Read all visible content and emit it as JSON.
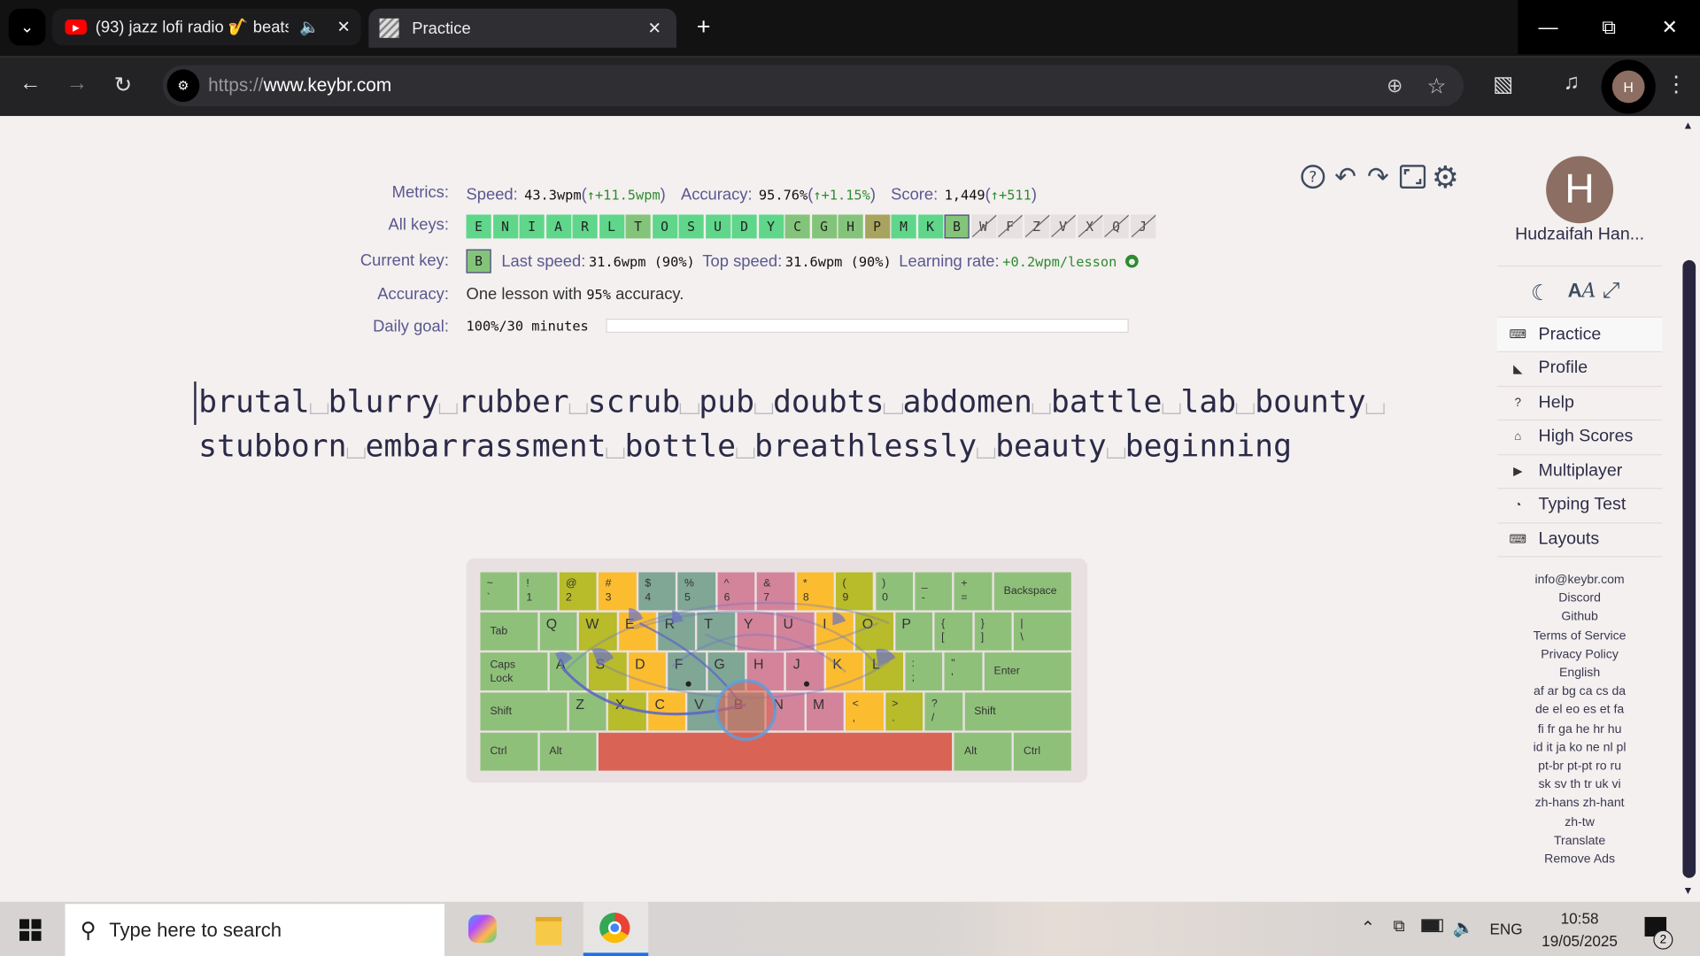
{
  "browser": {
    "tabs": [
      {
        "title": "(93) jazz lofi radio 🎷 beats",
        "active": false,
        "audio": true
      },
      {
        "title": "Practice",
        "active": true
      }
    ],
    "url_scheme": "https://",
    "url_host": "www.keybr.com",
    "profile_initial": "H"
  },
  "metrics": {
    "label": "Metrics:",
    "speed_label": "Speed:",
    "speed": "43.3wpm",
    "speed_delta": "↑+11.5wpm",
    "accuracy_label": "Accuracy:",
    "accuracy": "95.76%",
    "accuracy_delta": "↑+1.15%",
    "score_label": "Score:",
    "score": "1,449",
    "score_delta": "↑+511"
  },
  "all_keys": {
    "label": "All keys:",
    "keys": [
      {
        "k": "E",
        "s": "good"
      },
      {
        "k": "N",
        "s": "good"
      },
      {
        "k": "I",
        "s": "good"
      },
      {
        "k": "A",
        "s": "good"
      },
      {
        "k": "R",
        "s": "good"
      },
      {
        "k": "L",
        "s": "good"
      },
      {
        "k": "T",
        "s": "mid"
      },
      {
        "k": "O",
        "s": "good"
      },
      {
        "k": "S",
        "s": "good"
      },
      {
        "k": "U",
        "s": "good"
      },
      {
        "k": "D",
        "s": "good"
      },
      {
        "k": "Y",
        "s": "good"
      },
      {
        "k": "C",
        "s": "mid"
      },
      {
        "k": "G",
        "s": "mid"
      },
      {
        "k": "H",
        "s": "mid"
      },
      {
        "k": "P",
        "s": "tan"
      },
      {
        "k": "M",
        "s": "good"
      },
      {
        "k": "K",
        "s": "good"
      },
      {
        "k": "B",
        "s": "cur"
      },
      {
        "k": "W",
        "s": "lock"
      },
      {
        "k": "F",
        "s": "lock"
      },
      {
        "k": "Z",
        "s": "lock"
      },
      {
        "k": "V",
        "s": "lock"
      },
      {
        "k": "X",
        "s": "lock"
      },
      {
        "k": "Q",
        "s": "lock"
      },
      {
        "k": "J",
        "s": "lock"
      }
    ]
  },
  "current_key": {
    "label": "Current key:",
    "key": "B",
    "last_speed_label": "Last speed:",
    "last_speed": "31.6wpm (90%)",
    "top_speed_label": "Top speed:",
    "top_speed": "31.6wpm (90%)",
    "learning_rate_label": "Learning rate:",
    "learning_rate": "+0.2wpm/lesson"
  },
  "accuracy_row": {
    "label": "Accuracy:",
    "prefix": "One lesson with ",
    "value": "95%",
    "suffix": " accuracy."
  },
  "daily_goal": {
    "label": "Daily goal:",
    "value": "100%/30 minutes",
    "progress": 1.0
  },
  "lesson_text": [
    "brutal",
    "blurry",
    "rubber",
    "scrub",
    "pub",
    "doubts",
    "abdomen",
    "battle",
    "lab",
    "bounty",
    "|",
    "stubborn",
    "embarrassment",
    "bottle",
    "breathlessly",
    "beauty",
    "beginning"
  ],
  "sidebar": {
    "user_name": "Hudzaifah Han...",
    "avatar_initial": "H",
    "menu": [
      {
        "label": "Practice",
        "icon": "keyboard-icon",
        "glyph": "⌨",
        "active": true
      },
      {
        "label": "Profile",
        "icon": "chart-icon",
        "glyph": "◣"
      },
      {
        "label": "Help",
        "icon": "help-icon",
        "glyph": "?"
      },
      {
        "label": "High Scores",
        "icon": "trophy-icon",
        "glyph": "⌂"
      },
      {
        "label": "Multiplayer",
        "icon": "car-icon",
        "glyph": "▶"
      },
      {
        "label": "Typing Test",
        "icon": "gauge-icon",
        "glyph": "◔"
      },
      {
        "label": "Layouts",
        "icon": "keyboard-icon",
        "glyph": "⌨"
      }
    ],
    "footer": [
      "info@keybr.com",
      "Discord",
      "Github",
      "Terms of Service",
      "Privacy Policy",
      "English",
      "af ar bg ca cs da",
      "de el eo es et fa",
      "fi fr ga he hr hu",
      "id it ja ko ne nl pl",
      "pt-br pt-pt ro ru",
      "sk sv th tr uk vi",
      "zh-hans zh-hant",
      "zh-tw",
      "Translate",
      "Remove Ads"
    ]
  },
  "keyboard": {
    "finger_colors": {
      "lp": "#8fc07a",
      "lr": "#b8bb2a",
      "lm": "#fbbd2f",
      "li": "#80a695",
      "ri": "#d3849a",
      "rm": "#fbbd2f",
      "rr": "#b8bb2a",
      "rp": "#8fc07a",
      "th": "#d96455"
    },
    "rows": [
      [
        [
          "~",
          "`",
          "lp"
        ],
        [
          "!",
          "1",
          "lp"
        ],
        [
          "@",
          "2",
          "lr"
        ],
        [
          "#",
          "3",
          "lm"
        ],
        [
          "$",
          "4",
          "li"
        ],
        [
          "%",
          "5",
          "li"
        ],
        [
          "^",
          "6",
          "ri"
        ],
        [
          "&",
          "7",
          "ri"
        ],
        [
          "*",
          "8",
          "rm"
        ],
        [
          "(",
          "9",
          "rr"
        ],
        [
          ")",
          "0",
          "rp"
        ],
        [
          "_",
          "-",
          "rp"
        ],
        [
          "+",
          "=",
          "rp"
        ],
        [
          "Backspace",
          "",
          "rp"
        ]
      ],
      [
        [
          "Tab",
          "",
          "lp"
        ],
        [
          "Q",
          "",
          "lp"
        ],
        [
          "W",
          "",
          "lr"
        ],
        [
          "E",
          "",
          "lm"
        ],
        [
          "R",
          "",
          "li"
        ],
        [
          "T",
          "",
          "li"
        ],
        [
          "Y",
          "",
          "ri"
        ],
        [
          "U",
          "",
          "ri"
        ],
        [
          "I",
          "",
          "rm"
        ],
        [
          "O",
          "",
          "rr"
        ],
        [
          "P",
          "",
          "rp"
        ],
        [
          "{",
          "[",
          "rp"
        ],
        [
          "}",
          "]",
          "rp"
        ],
        [
          "|",
          "\\",
          "rp"
        ]
      ],
      [
        [
          "Caps Lock",
          "",
          "lp"
        ],
        [
          "A",
          "",
          "lp"
        ],
        [
          "S",
          "",
          "lr"
        ],
        [
          "D",
          "",
          "lm"
        ],
        [
          "F",
          "",
          "li"
        ],
        [
          "G",
          "",
          "li"
        ],
        [
          "H",
          "",
          "ri"
        ],
        [
          "J",
          "",
          "ri"
        ],
        [
          "K",
          "",
          "rm"
        ],
        [
          "L",
          "",
          "rr"
        ],
        [
          ":",
          ";",
          "rp"
        ],
        [
          "\"",
          "'",
          "rp"
        ],
        [
          "Enter",
          "",
          "rp"
        ]
      ],
      [
        [
          "Shift",
          "",
          "lp"
        ],
        [
          "Z",
          "",
          "lp"
        ],
        [
          "X",
          "",
          "lr"
        ],
        [
          "C",
          "",
          "lm"
        ],
        [
          "V",
          "",
          "li"
        ],
        [
          "B",
          "",
          "li"
        ],
        [
          "N",
          "",
          "ri"
        ],
        [
          "M",
          "",
          "ri"
        ],
        [
          "<",
          ",",
          "rm"
        ],
        [
          ">",
          ".",
          "rr"
        ],
        [
          "?",
          "/",
          "rp"
        ],
        [
          "Shift",
          "",
          "rp"
        ]
      ],
      [
        [
          "Ctrl",
          "",
          "lp"
        ],
        [
          "Alt",
          "",
          "lp"
        ],
        [
          "",
          "",
          "th"
        ],
        [
          "Alt",
          "",
          "rp"
        ],
        [
          "Ctrl",
          "",
          "rp"
        ]
      ]
    ]
  },
  "taskbar": {
    "search_placeholder": "Type here to search",
    "language": "ENG",
    "time": "10:58",
    "date": "19/05/2025",
    "notifications": "2"
  }
}
